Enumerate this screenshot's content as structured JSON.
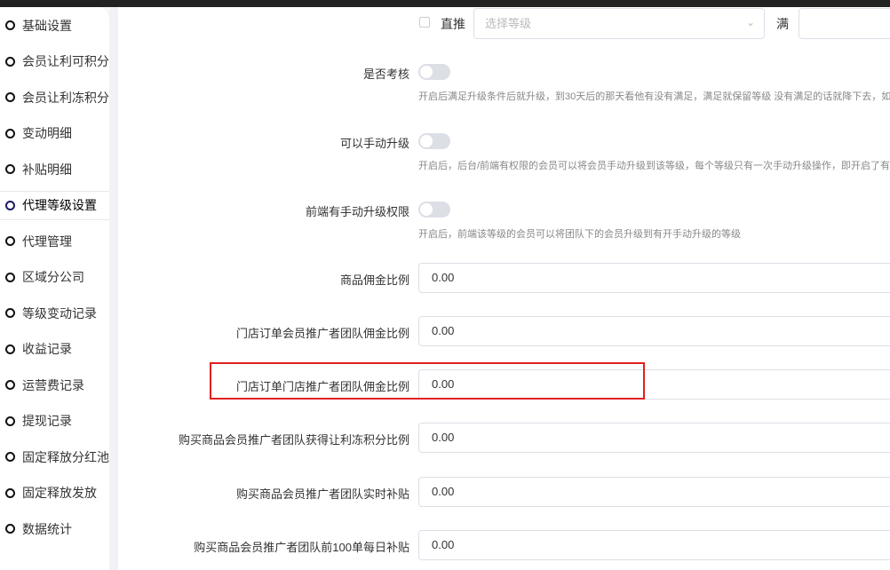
{
  "sidebar": {
    "items": [
      "基础设置",
      "会员让利可积分",
      "会员让利冻积分",
      "变动明细",
      "补贴明细",
      "代理等级设置",
      "代理管理",
      "区域分公司",
      "等级变动记录",
      "收益记录",
      "运营费记录",
      "提现记录",
      "固定释放分红池",
      "固定释放发放",
      "数据统计"
    ],
    "active": "代理等级设置"
  },
  "top_row": {
    "checkbox_label": "直推",
    "select_placeholder": "选择等级",
    "full_label": "满"
  },
  "toggles": [
    {
      "label": "是否考核",
      "on": false,
      "help": "开启后满足升级条件后就升级，到30天后的那天看他有没有满足，满足就保留等级 没有满足的话就降下去，如果"
    },
    {
      "label": "可以手动升级",
      "on": false,
      "help": "开启后，后台/前端有权限的会员可以将会员手动升级到该等级，每个等级只有一次手动升级操作，即开启了有手"
    },
    {
      "label": "前端有手动升级权限",
      "on": false,
      "help": "开启后，前端该等级的会员可以将团队下的会员升级到有开手动升级的等级"
    }
  ],
  "fields": [
    {
      "label": "商品佣金比例",
      "value": "0.00"
    },
    {
      "label": "门店订单会员推广者团队佣金比例",
      "value": "0.00"
    },
    {
      "label": "门店订单门店推广者团队佣金比例",
      "value": "0.00"
    },
    {
      "label": "购买商品会员推广者团队获得让利冻积分比例",
      "value": "0.00"
    },
    {
      "label": "购买商品会员推广者团队实时补贴",
      "value": "0.00"
    },
    {
      "label": "购买商品会员推广者团队前100单每日补贴",
      "value": "0.00"
    }
  ]
}
